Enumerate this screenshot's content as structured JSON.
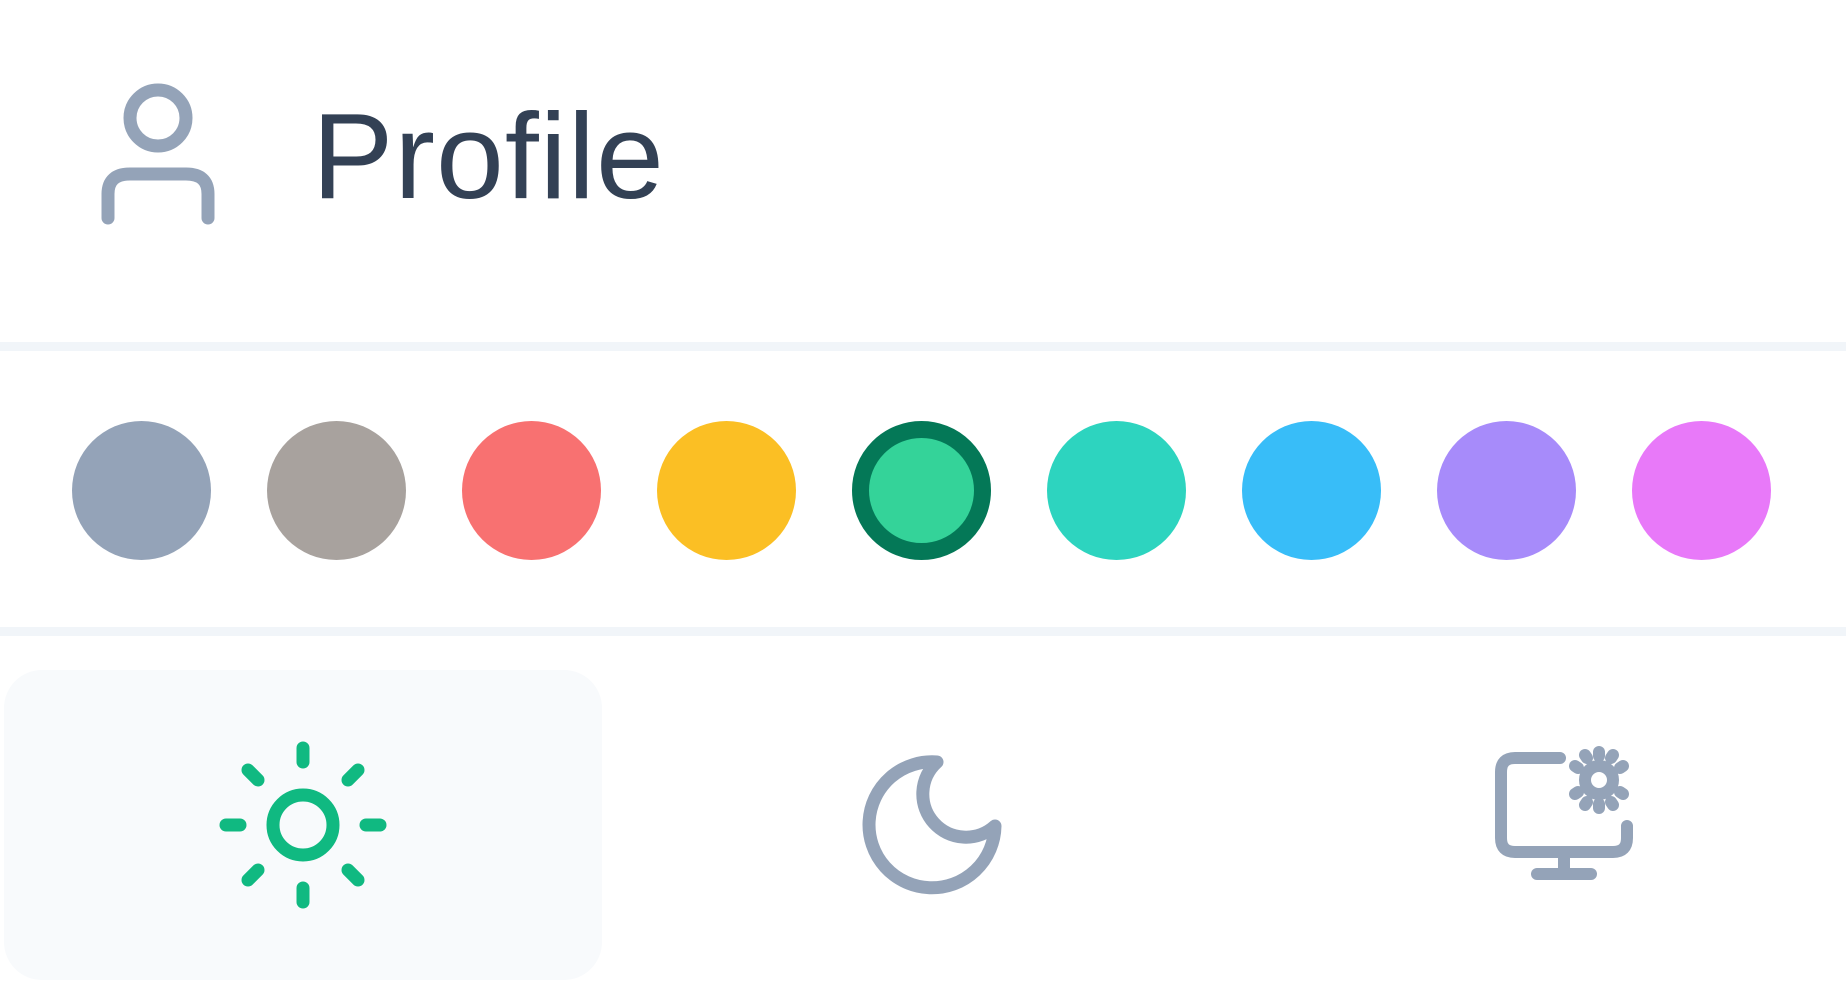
{
  "profile": {
    "label": "Profile",
    "icon": "user-icon",
    "icon_color": "#94a3b8",
    "label_color": "#334155"
  },
  "swatches": [
    {
      "name": "slate",
      "color": "#94a3b8",
      "selected": false
    },
    {
      "name": "stone",
      "color": "#a8a29e",
      "selected": false
    },
    {
      "name": "red",
      "color": "#f87171",
      "selected": false
    },
    {
      "name": "amber",
      "color": "#fbbf24",
      "selected": false
    },
    {
      "name": "emerald",
      "color": "#34d399",
      "selected": true,
      "ring_color": "#047857"
    },
    {
      "name": "teal",
      "color": "#2dd4bf",
      "selected": false
    },
    {
      "name": "sky",
      "color": "#38bdf8",
      "selected": false
    },
    {
      "name": "violet",
      "color": "#a78bfa",
      "selected": false
    },
    {
      "name": "fuchsia",
      "color": "#e879f9",
      "selected": false
    }
  ],
  "theme_modes": [
    {
      "name": "light",
      "icon": "sun-icon",
      "active": true,
      "color": "#10b981"
    },
    {
      "name": "dark",
      "icon": "moon-icon",
      "active": false,
      "color": "#94a3b8"
    },
    {
      "name": "system",
      "icon": "monitor-settings-icon",
      "active": false,
      "color": "#94a3b8"
    }
  ]
}
